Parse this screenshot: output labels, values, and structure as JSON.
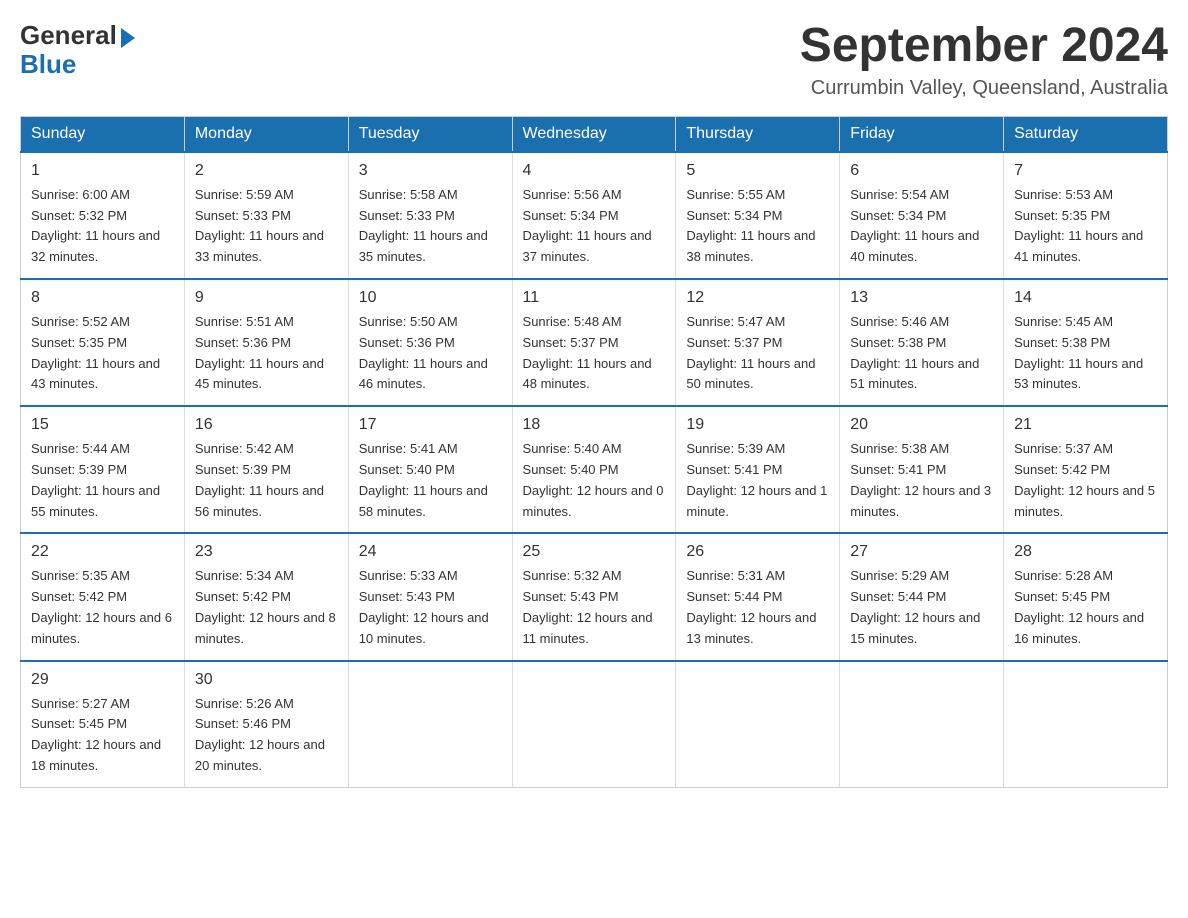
{
  "logo": {
    "general": "General",
    "blue": "Blue"
  },
  "title": "September 2024",
  "location": "Currumbin Valley, Queensland, Australia",
  "days_of_week": [
    "Sunday",
    "Monday",
    "Tuesday",
    "Wednesday",
    "Thursday",
    "Friday",
    "Saturday"
  ],
  "weeks": [
    [
      {
        "day": "1",
        "sunrise": "6:00 AM",
        "sunset": "5:32 PM",
        "daylight": "11 hours and 32 minutes."
      },
      {
        "day": "2",
        "sunrise": "5:59 AM",
        "sunset": "5:33 PM",
        "daylight": "11 hours and 33 minutes."
      },
      {
        "day": "3",
        "sunrise": "5:58 AM",
        "sunset": "5:33 PM",
        "daylight": "11 hours and 35 minutes."
      },
      {
        "day": "4",
        "sunrise": "5:56 AM",
        "sunset": "5:34 PM",
        "daylight": "11 hours and 37 minutes."
      },
      {
        "day": "5",
        "sunrise": "5:55 AM",
        "sunset": "5:34 PM",
        "daylight": "11 hours and 38 minutes."
      },
      {
        "day": "6",
        "sunrise": "5:54 AM",
        "sunset": "5:34 PM",
        "daylight": "11 hours and 40 minutes."
      },
      {
        "day": "7",
        "sunrise": "5:53 AM",
        "sunset": "5:35 PM",
        "daylight": "11 hours and 41 minutes."
      }
    ],
    [
      {
        "day": "8",
        "sunrise": "5:52 AM",
        "sunset": "5:35 PM",
        "daylight": "11 hours and 43 minutes."
      },
      {
        "day": "9",
        "sunrise": "5:51 AM",
        "sunset": "5:36 PM",
        "daylight": "11 hours and 45 minutes."
      },
      {
        "day": "10",
        "sunrise": "5:50 AM",
        "sunset": "5:36 PM",
        "daylight": "11 hours and 46 minutes."
      },
      {
        "day": "11",
        "sunrise": "5:48 AM",
        "sunset": "5:37 PM",
        "daylight": "11 hours and 48 minutes."
      },
      {
        "day": "12",
        "sunrise": "5:47 AM",
        "sunset": "5:37 PM",
        "daylight": "11 hours and 50 minutes."
      },
      {
        "day": "13",
        "sunrise": "5:46 AM",
        "sunset": "5:38 PM",
        "daylight": "11 hours and 51 minutes."
      },
      {
        "day": "14",
        "sunrise": "5:45 AM",
        "sunset": "5:38 PM",
        "daylight": "11 hours and 53 minutes."
      }
    ],
    [
      {
        "day": "15",
        "sunrise": "5:44 AM",
        "sunset": "5:39 PM",
        "daylight": "11 hours and 55 minutes."
      },
      {
        "day": "16",
        "sunrise": "5:42 AM",
        "sunset": "5:39 PM",
        "daylight": "11 hours and 56 minutes."
      },
      {
        "day": "17",
        "sunrise": "5:41 AM",
        "sunset": "5:40 PM",
        "daylight": "11 hours and 58 minutes."
      },
      {
        "day": "18",
        "sunrise": "5:40 AM",
        "sunset": "5:40 PM",
        "daylight": "12 hours and 0 minutes."
      },
      {
        "day": "19",
        "sunrise": "5:39 AM",
        "sunset": "5:41 PM",
        "daylight": "12 hours and 1 minute."
      },
      {
        "day": "20",
        "sunrise": "5:38 AM",
        "sunset": "5:41 PM",
        "daylight": "12 hours and 3 minutes."
      },
      {
        "day": "21",
        "sunrise": "5:37 AM",
        "sunset": "5:42 PM",
        "daylight": "12 hours and 5 minutes."
      }
    ],
    [
      {
        "day": "22",
        "sunrise": "5:35 AM",
        "sunset": "5:42 PM",
        "daylight": "12 hours and 6 minutes."
      },
      {
        "day": "23",
        "sunrise": "5:34 AM",
        "sunset": "5:42 PM",
        "daylight": "12 hours and 8 minutes."
      },
      {
        "day": "24",
        "sunrise": "5:33 AM",
        "sunset": "5:43 PM",
        "daylight": "12 hours and 10 minutes."
      },
      {
        "day": "25",
        "sunrise": "5:32 AM",
        "sunset": "5:43 PM",
        "daylight": "12 hours and 11 minutes."
      },
      {
        "day": "26",
        "sunrise": "5:31 AM",
        "sunset": "5:44 PM",
        "daylight": "12 hours and 13 minutes."
      },
      {
        "day": "27",
        "sunrise": "5:29 AM",
        "sunset": "5:44 PM",
        "daylight": "12 hours and 15 minutes."
      },
      {
        "day": "28",
        "sunrise": "5:28 AM",
        "sunset": "5:45 PM",
        "daylight": "12 hours and 16 minutes."
      }
    ],
    [
      {
        "day": "29",
        "sunrise": "5:27 AM",
        "sunset": "5:45 PM",
        "daylight": "12 hours and 18 minutes."
      },
      {
        "day": "30",
        "sunrise": "5:26 AM",
        "sunset": "5:46 PM",
        "daylight": "12 hours and 20 minutes."
      },
      null,
      null,
      null,
      null,
      null
    ]
  ],
  "labels": {
    "sunrise_prefix": "Sunrise: ",
    "sunset_prefix": "Sunset: ",
    "daylight_prefix": "Daylight: "
  }
}
